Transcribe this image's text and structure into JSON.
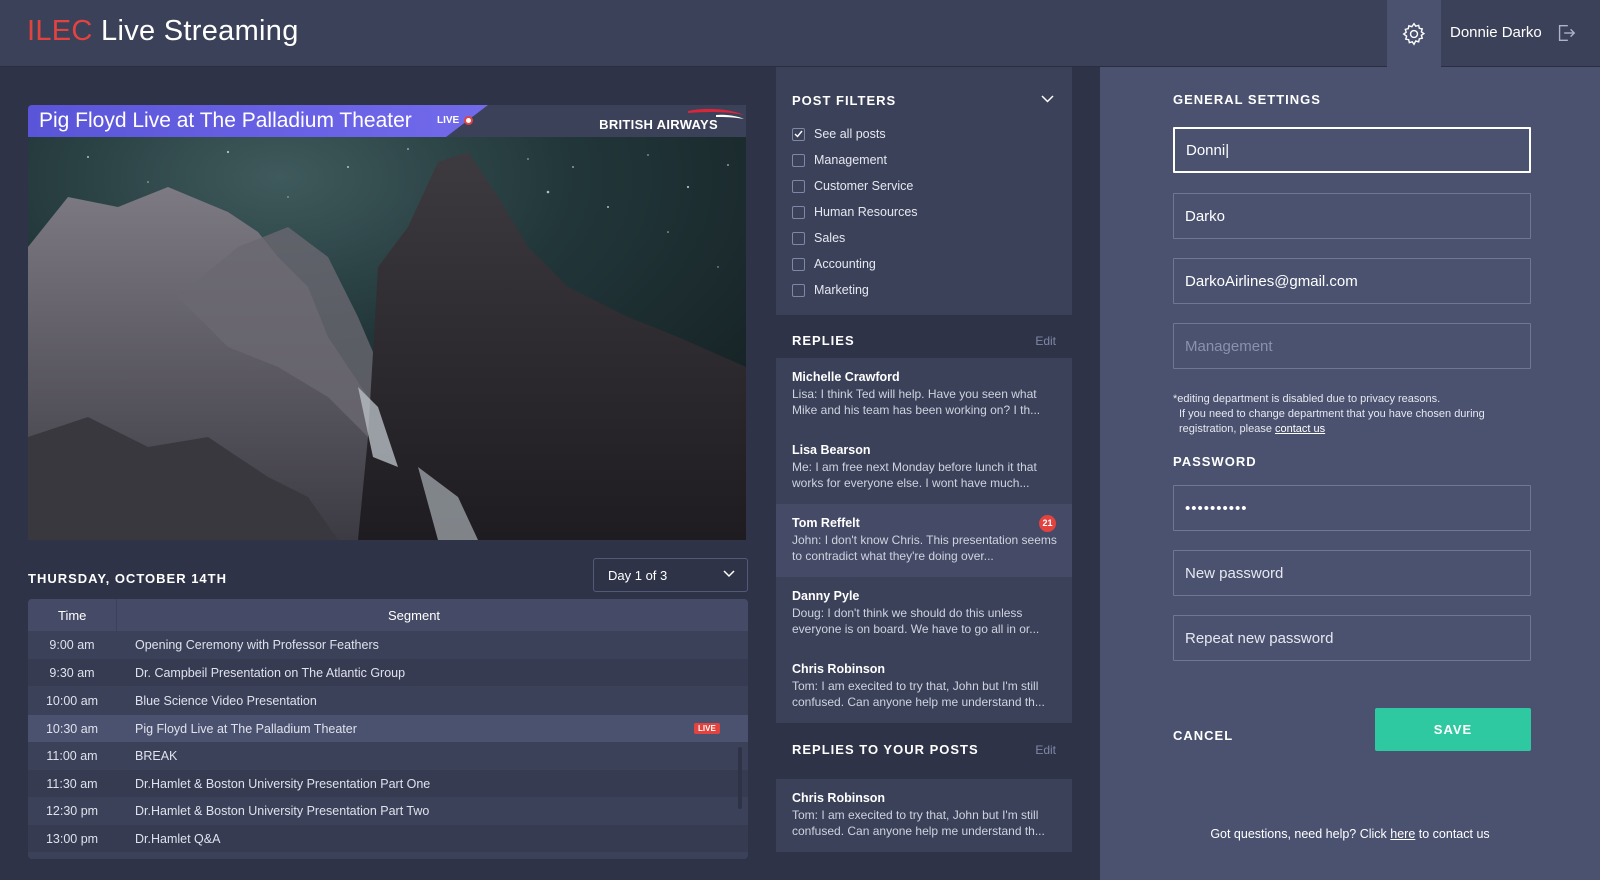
{
  "header": {
    "brand_prefix": "ILEC",
    "brand_suffix": " Live Streaming",
    "user_name": "Donnie Darko"
  },
  "video": {
    "title": "Pig Floyd Live at The Palladium Theater",
    "live_label": "LIVE",
    "sponsor": "BRITISH AIRWAYS"
  },
  "schedule": {
    "date_label": "THURSDAY, OCTOBER 14TH",
    "day_select": "Day 1 of 3",
    "col_time": "Time",
    "col_segment": "Segment",
    "rows": [
      {
        "time": "9:00 am",
        "segment": "Opening Ceremony with Professor Feathers"
      },
      {
        "time": "9:30 am",
        "segment": "Dr. Campbeil Presentation on The Atlantic Group"
      },
      {
        "time": "10:00 am",
        "segment": "Blue Science Video Presentation"
      },
      {
        "time": "10:30 am",
        "segment": "Pig Floyd Live at The Palladium Theater",
        "badge": "LIVE"
      },
      {
        "time": "11:00 am",
        "segment": "BREAK"
      },
      {
        "time": "11:30 am",
        "segment": "Dr.Hamlet & Boston University Presentation Part One"
      },
      {
        "time": "12:30 pm",
        "segment": "Dr.Hamlet & Boston University Presentation Part Two"
      },
      {
        "time": "13:00 pm",
        "segment": "Dr.Hamlet Q&A"
      }
    ]
  },
  "filters": {
    "title": "POST FILTERS",
    "items": [
      {
        "label": "See all posts",
        "checked": true
      },
      {
        "label": "Management",
        "checked": false
      },
      {
        "label": "Customer Service",
        "checked": false
      },
      {
        "label": "Human Resources",
        "checked": false
      },
      {
        "label": "Sales",
        "checked": false
      },
      {
        "label": "Accounting",
        "checked": false
      },
      {
        "label": "Marketing",
        "checked": false
      }
    ]
  },
  "replies": {
    "title": "REPLIES",
    "edit": "Edit",
    "items": [
      {
        "name": "Michelle Crawford",
        "text": "Lisa: I think Ted will help. Have you seen what Mike and his team has been working on? I th..."
      },
      {
        "name": "Lisa Bearson",
        "text": "Me: I am free next Monday before lunch it that works for everyone else. I wont have much..."
      },
      {
        "name": "Tom Reffelt",
        "text": "John: I don't know Chris. This presentation seems to contradict what they're doing over...",
        "count": "21"
      },
      {
        "name": "Danny Pyle",
        "text": "Doug: I don't think we should do this unless everyone is on board. We have to go all in or..."
      },
      {
        "name": "Chris Robinson",
        "text": "Tom: I am execited to try that, John but I'm still confused. Can anyone help me understand th..."
      }
    ]
  },
  "replies_to_posts": {
    "title": "REPLIES TO YOUR POSTS",
    "edit": "Edit",
    "items": [
      {
        "name": "Chris Robinson",
        "text": "Tom: I am execited to try that, John but I'm still confused. Can anyone help me understand th..."
      }
    ]
  },
  "settings": {
    "general_title": "GENERAL SETTINGS",
    "first_name": "Donni|",
    "last_name": "Darko",
    "email": "DarkoAirlines@gmail.com",
    "department": "Management",
    "note_line1": "*editing department is disabled due to privacy reasons.",
    "note_line2": "If you need to change department that you have chosen during registration, please",
    "note_link": "contact us",
    "password_title": "PASSWORD",
    "current_password": "••••••••••",
    "new_password_placeholder": "New password",
    "repeat_password_placeholder": "Repeat new password",
    "cancel_label": "CANCEL",
    "save_label": "SAVE",
    "help_prefix": "Got questions, need help? Click ",
    "help_link": "here",
    "help_suffix": " to contact us"
  },
  "colors": {
    "accent": "#2ec9a1",
    "brand_red": "#e2433f",
    "banner_purple": "#6a62e6"
  }
}
